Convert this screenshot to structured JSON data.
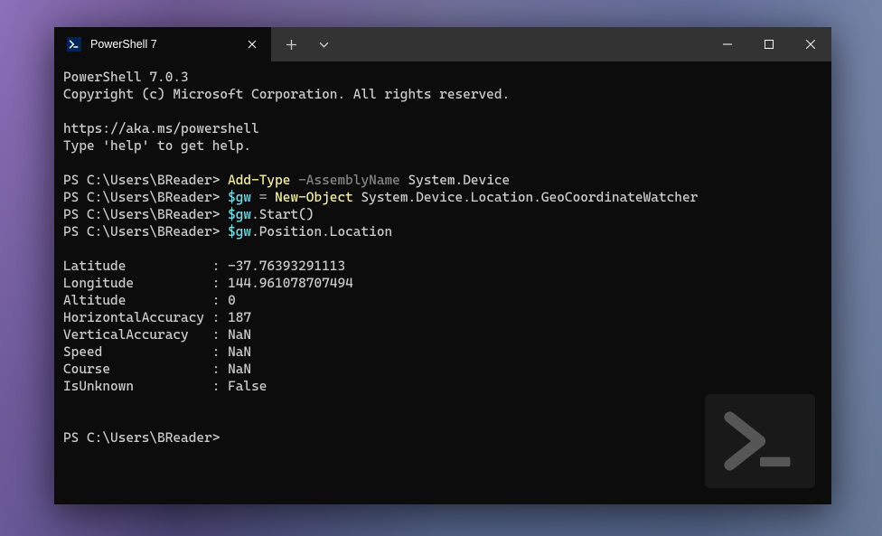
{
  "tab": {
    "title": "PowerShell 7"
  },
  "header": {
    "version": "PowerShell 7.0.3",
    "copyright": "Copyright (c) Microsoft Corporation. All rights reserved.",
    "url": "https://aka.ms/powershell",
    "help": "Type 'help' to get help."
  },
  "prompt": "PS C:\\Users\\BReader>",
  "commands": {
    "l1": {
      "cmd": "Add-Type",
      "param": "-AssemblyName",
      "arg": "System.Device"
    },
    "l2": {
      "var": "$gw",
      "op": "=",
      "cmd": "New-Object",
      "arg": "System.Device.Location.GeoCoordinateWatcher"
    },
    "l3": {
      "var": "$gw",
      "rest": ".Start()"
    },
    "l4": {
      "var": "$gw",
      "rest": ".Position.Location"
    }
  },
  "output": {
    "r1": "Latitude           : -37.76393291113",
    "r2": "Longitude          : 144.961078707494",
    "r3": "Altitude           : 0",
    "r4": "HorizontalAccuracy : 187",
    "r5": "VerticalAccuracy   : NaN",
    "r6": "Speed              : NaN",
    "r7": "Course             : NaN",
    "r8": "IsUnknown          : False"
  }
}
